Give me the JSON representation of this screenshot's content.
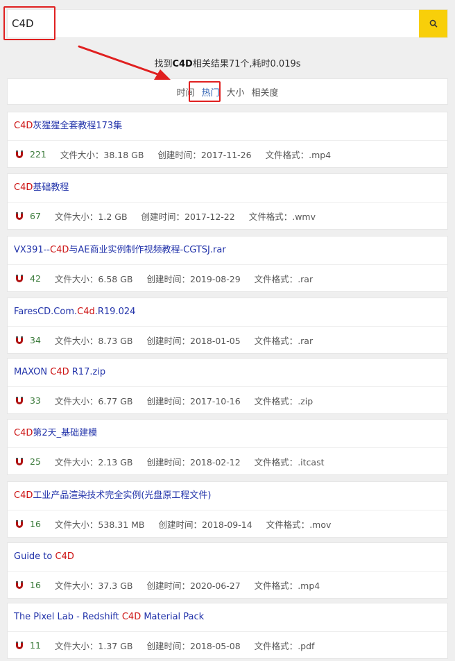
{
  "search": {
    "value": "C4D",
    "button_icon": "search-icon"
  },
  "summary": {
    "prefix": "找到",
    "keyword": "C4D",
    "suffix": "相关结果71个,耗时0.019s"
  },
  "sort": {
    "options": [
      "时间",
      "热门",
      "大小",
      "相关度"
    ],
    "active": "热门"
  },
  "annotation_color": "#e02020",
  "accent_color": "#f8cf0a",
  "labels": {
    "size": "文件大小：",
    "created": "创建时间：",
    "format": "文件格式："
  },
  "results": [
    {
      "title_before": "",
      "title_kw": "C4D",
      "title_after": "灰猩猩全套教程173集",
      "heat": "221",
      "size": "38.18 GB",
      "created": "2017-11-26",
      "format": ".mp4"
    },
    {
      "title_before": "",
      "title_kw": "C4D",
      "title_after": "基础教程",
      "heat": "67",
      "size": "1.2 GB",
      "created": "2017-12-22",
      "format": ".wmv"
    },
    {
      "title_before": "VX391--",
      "title_kw": "C4D",
      "title_after": "与AE商业实例制作视频教程-CGTSJ.rar",
      "heat": "42",
      "size": "6.58 GB",
      "created": "2019-08-29",
      "format": ".rar"
    },
    {
      "title_before": "FaresCD.Com.",
      "title_kw": "C4d",
      "title_after": ".R19.024",
      "heat": "34",
      "size": "8.73 GB",
      "created": "2018-01-05",
      "format": ".rar"
    },
    {
      "title_before": "MAXON ",
      "title_kw": "C4D",
      "title_after": " R17.zip",
      "heat": "33",
      "size": "6.77 GB",
      "created": "2017-10-16",
      "format": ".zip"
    },
    {
      "title_before": "",
      "title_kw": "C4D",
      "title_after": "第2天_基础建模",
      "heat": "25",
      "size": "2.13 GB",
      "created": "2018-02-12",
      "format": ".itcast"
    },
    {
      "title_before": "",
      "title_kw": "C4D",
      "title_after": "工业产品渲染技术完全实例(光盘原工程文件)",
      "heat": "16",
      "size": "538.31 MB",
      "created": "2018-09-14",
      "format": ".mov"
    },
    {
      "title_before": "Guide to ",
      "title_kw": "C4D",
      "title_after": "",
      "heat": "16",
      "size": "37.3 GB",
      "created": "2020-06-27",
      "format": ".mp4"
    },
    {
      "title_before": "The Pixel Lab - Redshift ",
      "title_kw": "C4D",
      "title_after": " Material Pack",
      "heat": "11",
      "size": "1.37 GB",
      "created": "2018-05-08",
      "format": ".pdf"
    }
  ]
}
